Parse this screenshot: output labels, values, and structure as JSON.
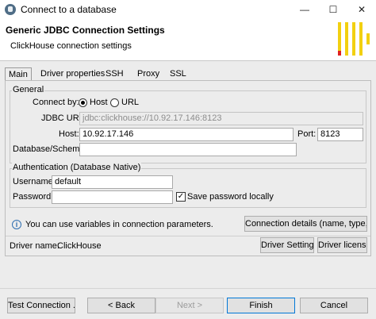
{
  "window": {
    "title": "Connect to a database",
    "minimize_glyph": "—",
    "maximize_glyph": "☐",
    "close_glyph": "✕"
  },
  "header": {
    "title": "Generic JDBC Connection Settings",
    "subtitle": "ClickHouse connection settings"
  },
  "tabs": [
    {
      "label": "Main",
      "active": true
    },
    {
      "label": "Driver properties",
      "active": false
    },
    {
      "label": "SSH",
      "active": false
    },
    {
      "label": "Proxy",
      "active": false
    },
    {
      "label": "SSL",
      "active": false
    }
  ],
  "general": {
    "group_label": "General",
    "connect_by_label": "Connect by:",
    "options": [
      {
        "label": "Host",
        "selected": true
      },
      {
        "label": "URL",
        "selected": false
      }
    ],
    "jdbc_url_label": "JDBC URL:",
    "jdbc_url_value": "jdbc:clickhouse://10.92.17.146:8123",
    "host_label": "Host:",
    "host_value": "10.92.17.146",
    "port_label": "Port:",
    "port_value": "8123",
    "database_label": "Database/Schema:",
    "database_value": ""
  },
  "auth": {
    "group_label": "Authentication (Database Native)",
    "username_label": "Username:",
    "username_value": "default",
    "password_label": "Password:",
    "password_value": "",
    "save_password_label": "Save password locally",
    "save_password_checked": true,
    "check_glyph": "✓"
  },
  "info": {
    "icon_glyph": "i",
    "text": "You can use variables in connection parameters.",
    "details_button": "Connection details (name, type, ... )"
  },
  "driver": {
    "name_label": "Driver name:",
    "name_value": "ClickHouse",
    "settings_button": "Driver Settings",
    "license_button": "Driver license"
  },
  "footer": {
    "test_button": "Test Connection ...",
    "back_button": "< Back",
    "next_button": "Next >",
    "finish_button": "Finish",
    "cancel_button": "Cancel"
  },
  "colors": {
    "logo_yellow": "#f2d010",
    "logo_red": "#e02020",
    "dialog_bg": "#ececec",
    "primary_border": "#0078d7"
  }
}
